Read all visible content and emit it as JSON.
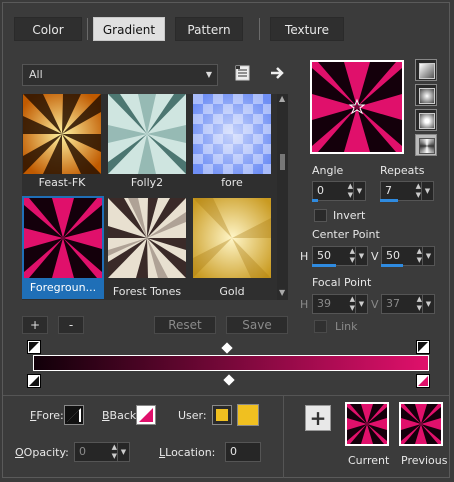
{
  "tabs": [
    {
      "label": "Color",
      "active": false
    },
    {
      "label": "Gradient",
      "active": true
    },
    {
      "label": "Pattern",
      "active": false
    },
    {
      "label": "Texture",
      "active": false
    }
  ],
  "category_dropdown": {
    "value": "All"
  },
  "thumbnails": [
    {
      "label": "Feast-FK",
      "selected": false
    },
    {
      "label": "Folly2",
      "selected": false
    },
    {
      "label": "fore",
      "selected": false
    },
    {
      "label": "Foregroun...",
      "selected": true
    },
    {
      "label": "Forest Tones",
      "selected": false
    },
    {
      "label": "Gold",
      "selected": false
    }
  ],
  "list_buttons": {
    "add": "+",
    "remove": "-",
    "reset": "Reset",
    "save": "Save"
  },
  "angle": {
    "label": "Angle",
    "value": "0"
  },
  "repeats": {
    "label": "Repeats",
    "value": "7"
  },
  "invert": {
    "label": "Invert",
    "checked": false
  },
  "center_point": {
    "label": "Center Point",
    "h_label": "H",
    "h_value": "50",
    "v_label": "V",
    "v_value": "50"
  },
  "focal_point": {
    "label": "Focal Point",
    "h_label": "H",
    "h_value": "39",
    "v_label": "V",
    "v_value": "37"
  },
  "link": {
    "label": "Link"
  },
  "fore": {
    "label": "Fore:"
  },
  "back": {
    "label": "Back:"
  },
  "user": {
    "label": "User:"
  },
  "opacity": {
    "label": "Opacity:",
    "value": "0"
  },
  "location": {
    "label": "Location:",
    "value": "0"
  },
  "add_button": {
    "label": "+"
  },
  "current": {
    "label": "Current"
  },
  "previous": {
    "label": "Previous"
  },
  "colors": {
    "accent": "#2f8be0",
    "gradient_start": "#110009",
    "gradient_end": "#e0106b",
    "user_swatch": "#f0c020"
  }
}
